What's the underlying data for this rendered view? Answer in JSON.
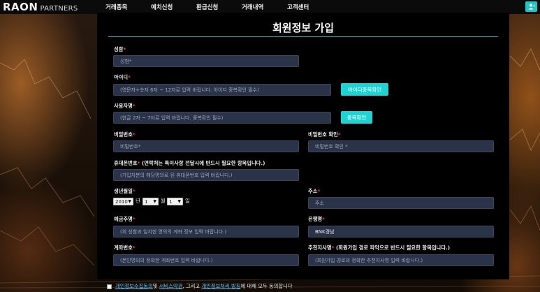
{
  "header": {
    "logo_main": "RAON",
    "logo_sub": "PARTNERS",
    "nav": [
      "거래종목",
      "예치신청",
      "환급신청",
      "거래내역",
      "고객센터"
    ]
  },
  "form": {
    "title": "회원정보 가입",
    "name": {
      "label": "성함",
      "placeholder": "성함*"
    },
    "userid": {
      "label": "아이디",
      "placeholder": "(영문자+숫자 6자 ~ 12자로 입력 바랍니다. 아이디 중복확인 필수)",
      "button": "아이디중복확인"
    },
    "nickname": {
      "label": "사용자명",
      "placeholder": "(한글 2자 ~ 7자로 입력 바랍니다. 중복확인 필수)",
      "button": "중복확인"
    },
    "password": {
      "label": "비밀번호",
      "placeholder": "비밀번호*"
    },
    "password_confirm": {
      "label": "비밀번호 확인",
      "placeholder": "비밀번호 확인 *"
    },
    "phone": {
      "label": "휴대폰번호",
      "note": " (연락처는 특이사항 전달시에 반드시 필요한 항목입니다.)",
      "placeholder": "(가입자분의 해당명의로 된 휴대폰번호 입력 바랍니다.)"
    },
    "birth": {
      "label": "생년월일",
      "year": "2010",
      "year_unit": "년",
      "month": "1",
      "month_unit": "월",
      "day": "1",
      "day_unit": "일"
    },
    "address": {
      "label": "주소",
      "placeholder": "주소"
    },
    "account_holder": {
      "label": "예금주명",
      "placeholder": "(위 성함과 일치한 명의의 계좌 정보 입력 바랍니다.)"
    },
    "bank": {
      "label": "은행명",
      "value": "BNK경남"
    },
    "account_no": {
      "label": "계좌번호",
      "placeholder": "(본인명의의 정확한 계좌번호 입력 바랍니다.)"
    },
    "referrer": {
      "label": "추천지사명",
      "note": " (회원가입 경로 파악으로 반드시 필요한 항목입니다.)",
      "placeholder": "(회원가입 경로의 정확한 추천지사명 입력 바랍니다.)"
    },
    "required_mark": "*"
  },
  "agreement": {
    "link1": "개인정보수집동의",
    "text1": "및 ",
    "link2": "서비스약관",
    "text2": ", 그리고 ",
    "link3": "개인정보처리 방침",
    "text3": "에 대해 모두 동의합니다"
  }
}
